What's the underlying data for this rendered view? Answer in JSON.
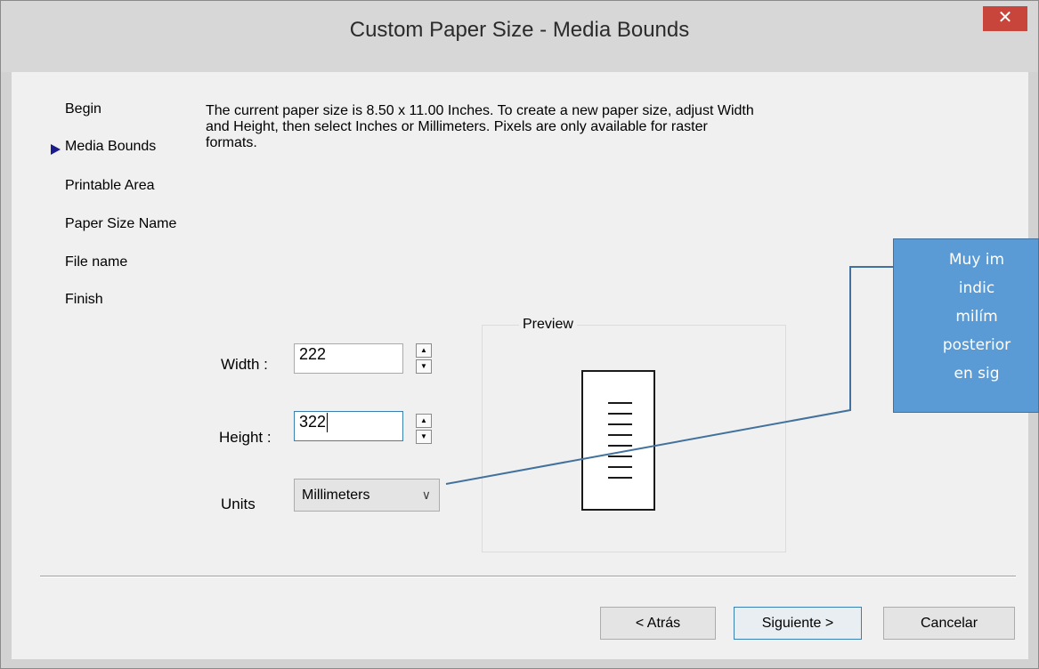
{
  "window": {
    "title": "Custom Paper Size - Media Bounds",
    "close_glyph": "✕"
  },
  "nav": {
    "items": [
      "Begin",
      "Media Bounds",
      "Printable Area",
      "Paper Size Name",
      "File name",
      "Finish"
    ],
    "current_index": 1,
    "current_marker_icon": "right-triangle-icon"
  },
  "description": "The current paper size is 8.50 x 11.00 Inches. To create a new paper size, adjust Width and Height, then select Inches or Millimeters. Pixels are only available for raster formats.",
  "form": {
    "width_label": "Width :",
    "width_value": "222",
    "height_label": "Height :",
    "height_value": "322",
    "units_label": "Units",
    "units_value": "Millimeters"
  },
  "preview": {
    "label": "Preview"
  },
  "buttons": {
    "back": "< Atrás",
    "next": "Siguiente >",
    "cancel": "Cancelar"
  },
  "callout": {
    "lines": [
      "Muy im",
      "indic",
      "milím",
      "posterior",
      "en sig"
    ],
    "fill_color": "#5b9bd5",
    "line_color": "#41719c"
  },
  "colors": {
    "close_button": "#c7453b",
    "nav_marker": "#1b1b8a",
    "default_button_border": "#3c7fb1"
  }
}
